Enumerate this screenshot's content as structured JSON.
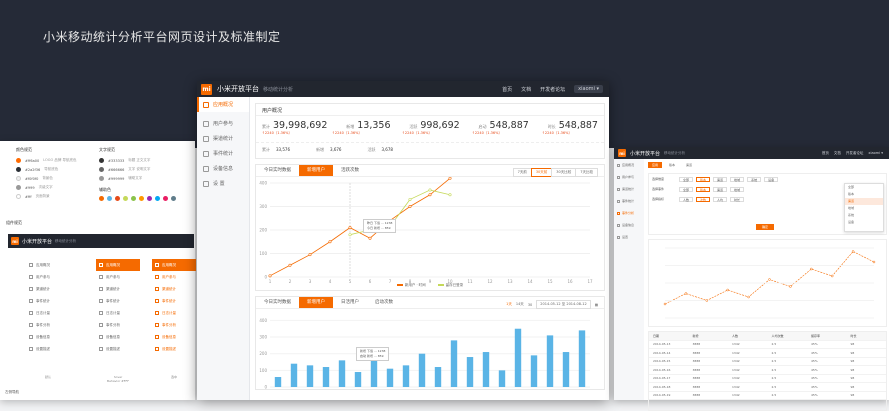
{
  "hero": {
    "title": "小米移动统计分析平台网页设计及标准制定"
  },
  "app": {
    "logo": "mi",
    "title": "小米开放平台",
    "subtitle": "移动统计分析"
  },
  "top_nav": [
    {
      "label": "首页"
    },
    {
      "label": "文档"
    },
    {
      "label": "开发者论坛"
    },
    {
      "label": "xiaomi ▾"
    }
  ],
  "sidebar": {
    "items": [
      {
        "label": "应用概况",
        "active": true
      },
      {
        "label": "用户参与"
      },
      {
        "label": "渠道统计"
      },
      {
        "label": "事件统计"
      },
      {
        "label": "设备信息"
      },
      {
        "label": "设 置"
      }
    ]
  },
  "overview": {
    "title": "用户概况",
    "kpis": [
      {
        "label": "累计",
        "value": "39,998,692",
        "change": "↑2240（1.36%）"
      },
      {
        "label": "新增",
        "value": "13,356",
        "change": "↑2240（1.36%）"
      },
      {
        "label": "活跃",
        "value": "998,692",
        "change": "↑2240（1.36%）"
      },
      {
        "label": "启动",
        "value": "548,887",
        "change": "↑2240（1.36%）"
      },
      {
        "label": "时长",
        "value": "548,887",
        "change": "↑2240（1.36%）"
      }
    ],
    "subs": [
      {
        "label": "累计",
        "value": "33,576"
      },
      {
        "label": "新增",
        "value": "3,676"
      },
      {
        "label": "活跃",
        "value": "3,678"
      }
    ]
  },
  "trend_panel": {
    "tabs": [
      {
        "label": "今日实时数据"
      },
      {
        "label": "新增用户",
        "active": true
      },
      {
        "label": "活跃次数"
      }
    ],
    "segments": [
      {
        "label": "7天前"
      },
      {
        "label": "30天前",
        "active": true
      },
      {
        "label": "30天比较"
      },
      {
        "label": "7天比较"
      }
    ],
    "tooltip": {
      "line1": "昨日",
      "line1_v": "下载 ... 1238",
      "line2": "今日",
      "line2_v": "新增 ... 859"
    }
  },
  "bar_panel": {
    "tabs": [
      {
        "label": "今日实时数据"
      },
      {
        "label": "新增用户",
        "active": true
      },
      {
        "label": "日活用户"
      },
      {
        "label": "启动次数"
      }
    ],
    "date": {
      "d1": "1天",
      "d2": "14天",
      "d3": "30",
      "range": "2014-05-12 至 2014-08-12"
    },
    "tooltip": {
      "line1": "新增",
      "line1_v": "下载 ... 1238",
      "line2": "启动",
      "line2_v": "新增 ... 859"
    }
  },
  "chart_data": [
    {
      "type": "line",
      "x": [
        1,
        2,
        3,
        4,
        5,
        6,
        7,
        8,
        9,
        10,
        11,
        12,
        13,
        14,
        15,
        16,
        17
      ],
      "ylim": [
        0,
        400
      ],
      "yticks": [
        0,
        100,
        200,
        300,
        400
      ],
      "series": [
        {
          "name": "新用户 · 时间",
          "color": "#f56a00",
          "values": [
            5,
            50,
            95,
            150,
            210,
            165,
            240,
            300,
            350,
            420
          ]
        },
        {
          "name": "留存已登录",
          "color": "#c5d95a",
          "values": [
            null,
            null,
            null,
            null,
            180,
            200,
            215,
            330,
            370,
            350
          ]
        }
      ]
    },
    {
      "type": "bar",
      "x": [
        1,
        2,
        3,
        4,
        5,
        6,
        7,
        8,
        9,
        10,
        11,
        12,
        13,
        14,
        15,
        16,
        17,
        18,
        19,
        20
      ],
      "ylim": [
        0,
        400
      ],
      "yticks": [
        0,
        100,
        200,
        300,
        400
      ],
      "values": [
        60,
        140,
        130,
        120,
        160,
        90,
        230,
        110,
        130,
        200,
        120,
        280,
        180,
        210,
        100,
        350,
        190,
        310,
        210,
        340
      ]
    }
  ],
  "left_card": {
    "color_title": "颜色规范",
    "text_title": "文字规范",
    "colors": [
      {
        "hex": "#ff6a00",
        "desc": "LOGO 品牌 导航底色",
        "color": "#ff6a00"
      },
      {
        "hex": "#2a2f36",
        "desc": "导航底色",
        "color": "#2a2f36"
      },
      {
        "hex": "#f0f0f0",
        "desc": "背景色",
        "color": "#f0f0f0"
      },
      {
        "hex": "#999",
        "desc": "次级文字",
        "color": "#999999"
      },
      {
        "hex": "#fff",
        "desc": "页面背景",
        "color": "#ffffff"
      }
    ],
    "texts": [
      {
        "hex": "#333333",
        "desc": "标题 正文文字",
        "color": "#333333"
      },
      {
        "hex": "#666666",
        "desc": "文字 说明文字",
        "color": "#666666"
      },
      {
        "hex": "#999999",
        "desc": "辅助文字",
        "color": "#999999"
      }
    ],
    "aux_title": "辅助色",
    "swatches": [
      "#f56a00",
      "#5ab4e6",
      "#e64a19",
      "#c5d95a",
      "#8bc34a",
      "#ff9800",
      "#9c27b0",
      "#03a9f4",
      "#e91e63",
      "#607d8b"
    ],
    "components_label": "组件规范",
    "mini_app": {
      "title": "小米开放平台",
      "subtitle": "移动统计分析"
    },
    "nav_cols": [
      {
        "items": [
          {
            "label": "应用概况"
          },
          {
            "label": "用户参与"
          },
          {
            "label": "渠道统计"
          },
          {
            "label": "事件统计"
          },
          {
            "label": "日志计量"
          },
          {
            "label": "事件分析"
          },
          {
            "label": "设备信息"
          },
          {
            "label": "设置描述"
          }
        ],
        "caption": "默认"
      },
      {
        "items": [
          {
            "label": "应用概况",
            "state": "act"
          },
          {
            "label": "用户参与"
          },
          {
            "label": "渠道统计"
          },
          {
            "label": "事件统计"
          },
          {
            "label": "日志计量"
          },
          {
            "label": "事件分析"
          },
          {
            "label": "设备信息"
          },
          {
            "label": "设置描述"
          }
        ],
        "caption": "hover\nBehavior #FFF"
      },
      {
        "items": [
          {
            "label": "应用概况",
            "state": "act"
          },
          {
            "label": "用户参与",
            "state": "alt"
          },
          {
            "label": "渠道统计",
            "state": "alt"
          },
          {
            "label": "事件统计",
            "state": "alt"
          },
          {
            "label": "日志计量",
            "state": "alt"
          },
          {
            "label": "事件分析",
            "state": "alt"
          },
          {
            "label": "设备信息",
            "state": "alt"
          },
          {
            "label": "设置描述",
            "state": "alt"
          }
        ],
        "caption": "选中"
      }
    ],
    "bottom": "左侧导航"
  },
  "right_win": {
    "tabs": [
      {
        "label": "应用",
        "active": true
      },
      {
        "label": "版本"
      },
      {
        "label": "渠道"
      }
    ],
    "filters": [
      {
        "label": "选择维度",
        "chips": [
          "全部",
          "版本",
          "渠道",
          "地域",
          "系统",
          "设备"
        ]
      },
      {
        "label": "选择事件",
        "chips": [
          "全部",
          "版本",
          "渠道",
          "地域"
        ]
      },
      {
        "label": "选择指标",
        "chips": [
          "人数",
          "次数",
          "人均",
          "时长"
        ]
      }
    ],
    "button": "确定",
    "dropdown": [
      "全部",
      "版本",
      "渠道",
      "地域",
      "系统",
      "设备"
    ],
    "side": [
      {
        "label": "应用概况"
      },
      {
        "label": "用户参与"
      },
      {
        "label": "渠道统计"
      },
      {
        "label": "事件统计"
      },
      {
        "label": "事件分析",
        "active": true
      },
      {
        "label": "设备信息"
      },
      {
        "label": "设置"
      }
    ],
    "table_head": [
      "日期",
      "新增",
      "人数",
      "人均次数",
      "留存率",
      "时长"
    ],
    "table_rows": [
      [
        "2014-05-13",
        "3888",
        "1342",
        "2.5",
        "45%",
        "98"
      ],
      [
        "2014-05-14",
        "3888",
        "1342",
        "2.5",
        "45%",
        "98"
      ],
      [
        "2014-05-15",
        "3888",
        "1342",
        "2.5",
        "45%",
        "98"
      ],
      [
        "2014-05-16",
        "3888",
        "1342",
        "2.5",
        "45%",
        "98"
      ],
      [
        "2014-05-17",
        "3888",
        "1342",
        "2.5",
        "45%",
        "98"
      ],
      [
        "2014-05-18",
        "3888",
        "1342",
        "2.5",
        "45%",
        "98"
      ],
      [
        "2014-05-19",
        "3888",
        "1342",
        "2.5",
        "45%",
        "98"
      ]
    ]
  }
}
